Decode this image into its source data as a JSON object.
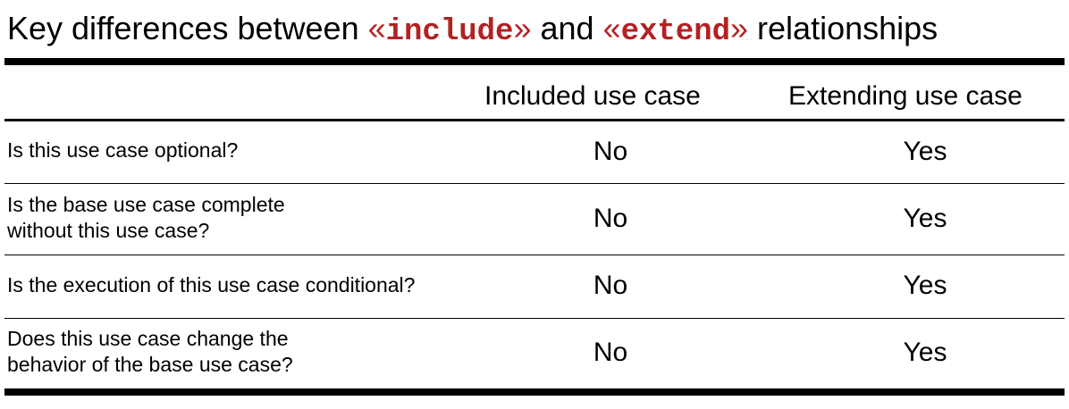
{
  "title": {
    "prefix": "Key differences between ",
    "kw1_open": "«",
    "kw1": "include",
    "kw1_close": "»",
    "middle": " and ",
    "kw2_open": "«",
    "kw2": "extend",
    "kw2_close": "»",
    "suffix": " relationships"
  },
  "colors": {
    "keyword": "#b22222",
    "text": "#000000",
    "background": "#ffffff"
  },
  "table": {
    "headers": [
      "",
      "Included use case",
      "Extending use case"
    ],
    "rows": [
      {
        "question_lines": [
          "Is this use case optional?"
        ],
        "included": "No",
        "extending": "Yes"
      },
      {
        "question_lines": [
          "Is the base use case complete",
          "without this use case?"
        ],
        "included": "No",
        "extending": "Yes"
      },
      {
        "question_lines": [
          "Is the execution of this use case conditional?"
        ],
        "included": "No",
        "extending": "Yes"
      },
      {
        "question_lines": [
          "Does this use case change the",
          "behavior of the base use case?"
        ],
        "included": "No",
        "extending": "Yes"
      }
    ]
  }
}
